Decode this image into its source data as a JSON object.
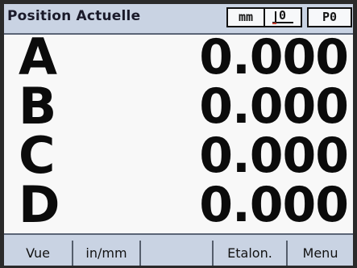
{
  "header": {
    "title": "Position Actuelle",
    "unit_indicator": "mm",
    "datum_indicator": "0",
    "position_indicator": "P0"
  },
  "axes": [
    {
      "letter": "A",
      "value": "0.000"
    },
    {
      "letter": "B",
      "value": "0.000"
    },
    {
      "letter": "C",
      "value": "0.000"
    },
    {
      "letter": "D",
      "value": "0.000"
    }
  ],
  "softkeys": [
    {
      "label": "Vue"
    },
    {
      "label": "in/mm"
    },
    {
      "label": ""
    },
    {
      "label": "Etalon."
    },
    {
      "label": "Menu"
    }
  ],
  "colors": {
    "screen_background": "#c9d3e3",
    "display_background": "#f8f8f8",
    "text": "#0b0b0b"
  }
}
